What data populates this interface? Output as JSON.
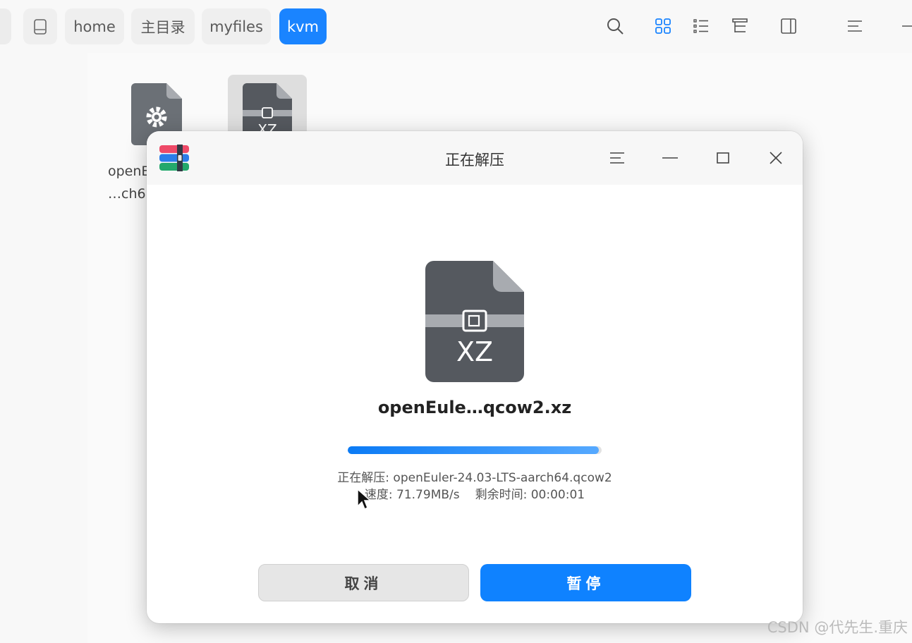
{
  "toolbar": {
    "breadcrumbs": [
      {
        "label": ""
      },
      {
        "label": "home"
      },
      {
        "label": "主目录"
      },
      {
        "label": "myfiles"
      },
      {
        "label": "kvm"
      }
    ],
    "active_crumb": "kvm",
    "icons": [
      "search-icon",
      "icon-view-icon",
      "list-view-icon",
      "tree-view-icon",
      "detail-panel-icon",
      "menu-icon",
      "minimize-icon"
    ]
  },
  "files": [
    {
      "name_line1": "openE",
      "name_line2": "…ch6",
      "icon": "settings-file-icon"
    },
    {
      "name_line1": "",
      "name_line2": "",
      "icon": "xz-archive-icon",
      "badge": "XZ"
    }
  ],
  "dialog": {
    "title": "正在解压",
    "archive_badge": "XZ",
    "archive_name": "openEule…qcow2.xz",
    "progress": 0.99,
    "status_line1": "正在解压: openEuler-24.03-LTS-aarch64.qcow2",
    "speed": "速度: 71.79MB/s",
    "remaining": "剩余时间: 00:00:01",
    "cancel_label": "取消",
    "pause_label": "暂停"
  },
  "watermark": "CSDN @代先生.重庆",
  "colors": {
    "accent": "#1a84ff",
    "file_icon_dark": "#55595f"
  }
}
